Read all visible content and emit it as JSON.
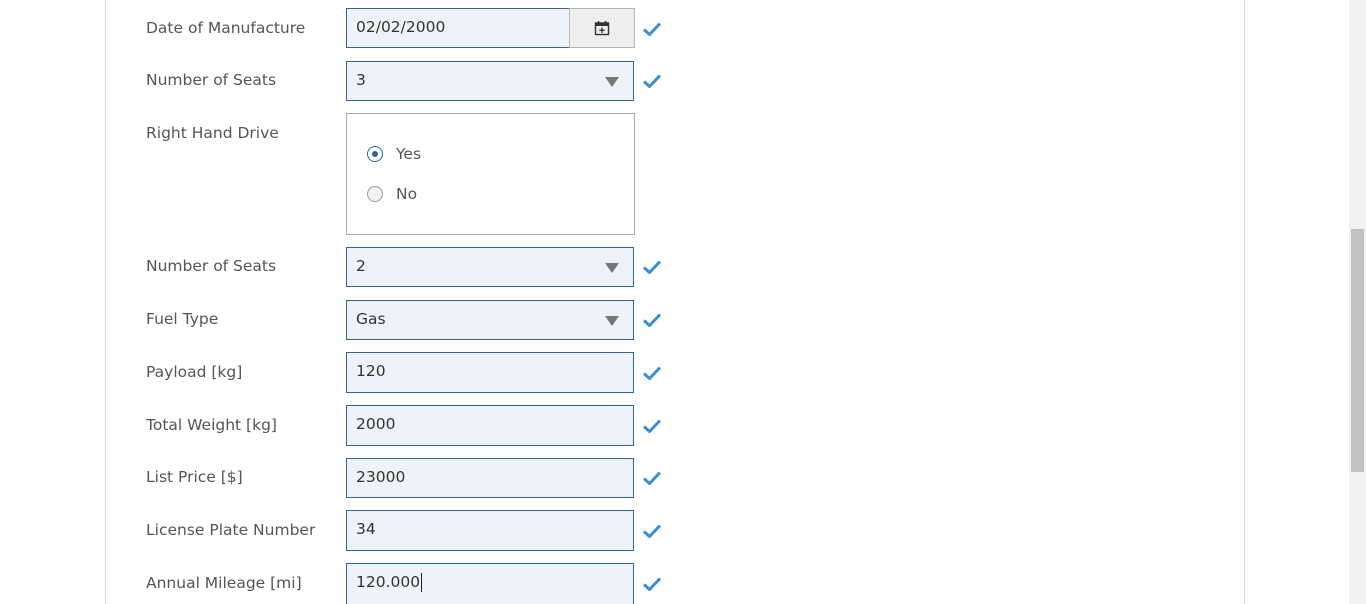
{
  "form": {
    "date_of_manufacture": {
      "label": "Date of Manufacture",
      "value": "02/02/2000",
      "calendar_icon": "calendar-icon"
    },
    "number_of_seats_1": {
      "label": "Number of Seats",
      "value": "3"
    },
    "right_hand_drive": {
      "label": "Right Hand Drive",
      "options": [
        "Yes",
        "No"
      ],
      "selected": "Yes"
    },
    "number_of_seats_2": {
      "label": "Number of Seats",
      "value": "2"
    },
    "fuel_type": {
      "label": "Fuel Type",
      "value": "Gas"
    },
    "payload": {
      "label": "Payload [kg]",
      "value": "120"
    },
    "total_weight": {
      "label": "Total Weight [kg]",
      "value": "2000"
    },
    "list_price": {
      "label": "List Price [$]",
      "value": "23000"
    },
    "license_plate": {
      "label": "License Plate Number",
      "value": "34"
    },
    "annual_mileage": {
      "label": "Annual Mileage [mi]",
      "value": "120.000"
    }
  },
  "colors": {
    "valid_check": "#3a8fd0",
    "field_border": "#2d6598",
    "field_bg": "#eef3fa"
  },
  "icons": {
    "valid": "checkmark-icon",
    "dropdown": "dropdown-arrow-icon"
  }
}
